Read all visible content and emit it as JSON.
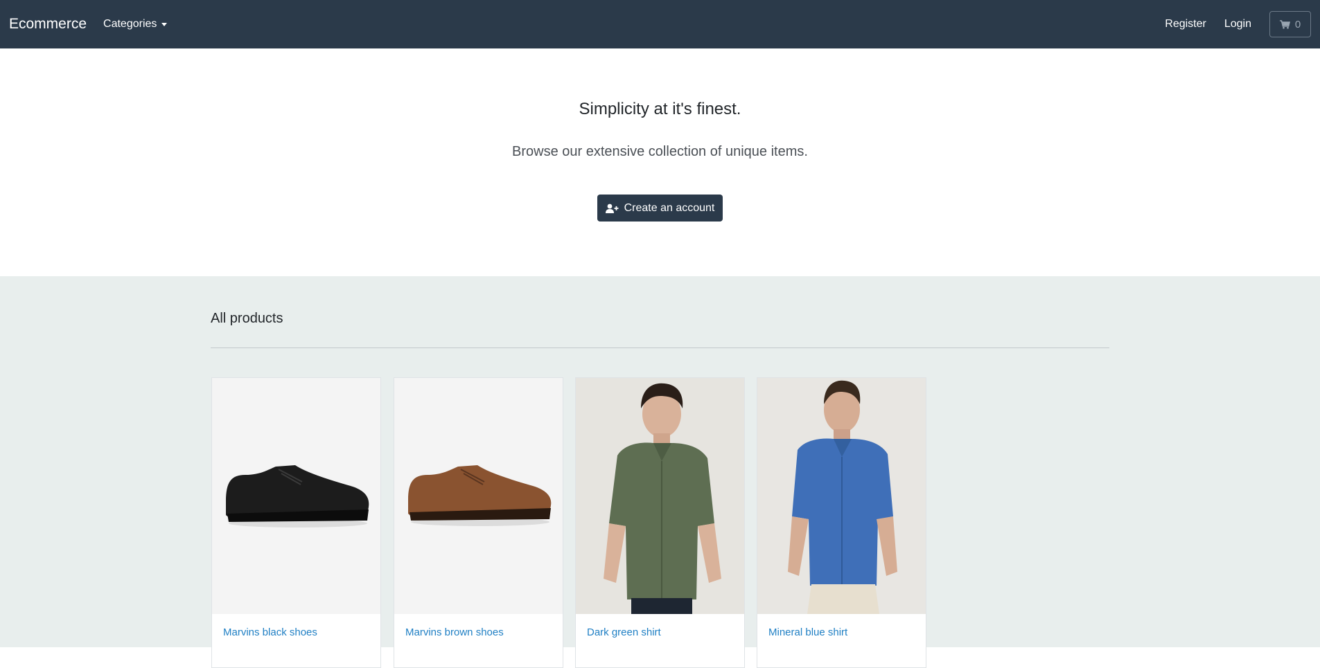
{
  "navbar": {
    "brand": "Ecommerce",
    "categories_label": "Categories",
    "register_label": "Register",
    "login_label": "Login",
    "cart_count": "0",
    "cart_icon": "shopping-cart-icon"
  },
  "hero": {
    "title": "Simplicity at it's finest.",
    "subtitle": "Browse our extensive collection of unique items.",
    "cta_label": "Create an account",
    "cta_icon": "user-plus-icon"
  },
  "products": {
    "section_title": "All products",
    "items": [
      {
        "name": "Marvins black shoes",
        "image": "black-shoe",
        "color": "#1c1c1c"
      },
      {
        "name": "Marvins brown shoes",
        "image": "brown-shoe",
        "color": "#8a5330"
      },
      {
        "name": "Dark green shirt",
        "image": "green-shirt",
        "color": "#5e6e52"
      },
      {
        "name": "Mineral blue shirt",
        "image": "blue-shirt",
        "color": "#3f6fb8"
      }
    ]
  },
  "colors": {
    "navbar_bg": "#2b3a4a",
    "link": "#1f7fc4",
    "products_bg": "#e8eeed"
  }
}
